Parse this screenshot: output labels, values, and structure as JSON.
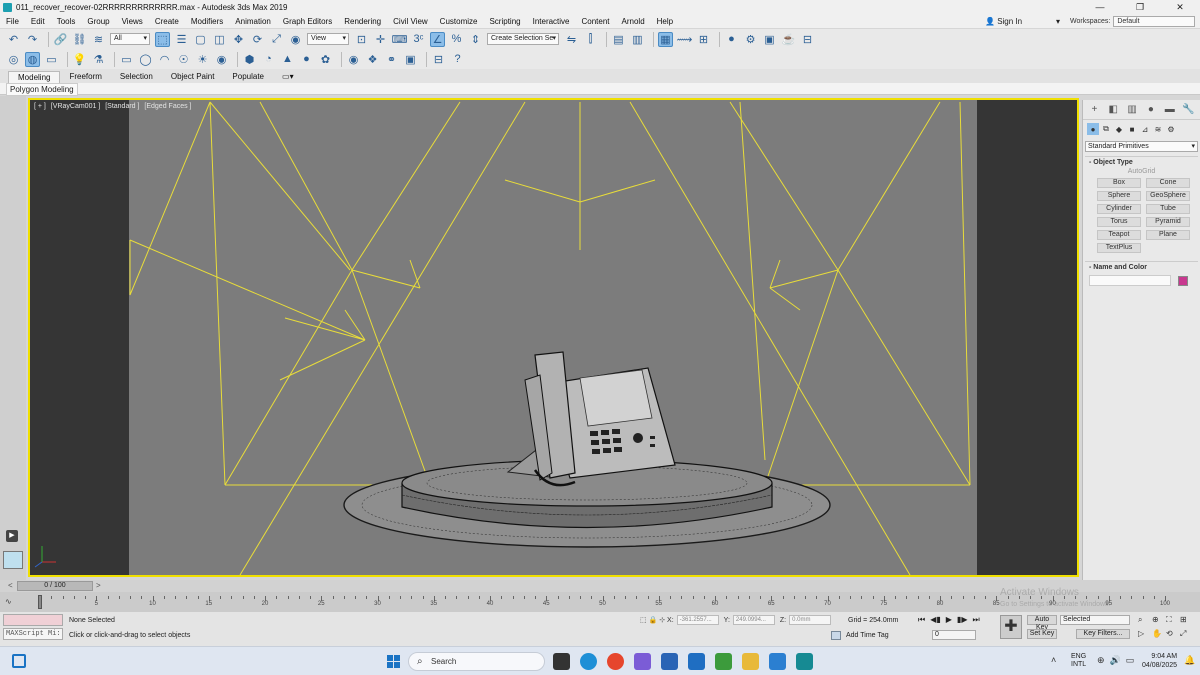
{
  "window": {
    "title": "011_recover_recover-02RRRRRRRRRRRRR.max - Autodesk 3ds Max 2019",
    "min": "—",
    "max": "❐",
    "close": "✕"
  },
  "menu": [
    "File",
    "Edit",
    "Tools",
    "Group",
    "Views",
    "Create",
    "Modifiers",
    "Animation",
    "Graph Editors",
    "Rendering",
    "Civil View",
    "Customize",
    "Scripting",
    "Interactive",
    "Content",
    "Arnold",
    "Help"
  ],
  "signin": {
    "label": "Sign In"
  },
  "workspaces": {
    "label": "Workspaces:",
    "value": "Default"
  },
  "toolbar1": {
    "filter_value": "All",
    "refcoord_value": "View",
    "selection_set": "Create Selection Se"
  },
  "ribbon": {
    "tabs": [
      "Modeling",
      "Freeform",
      "Selection",
      "Object Paint",
      "Populate"
    ],
    "active": "Modeling",
    "sub": "Polygon Modeling"
  },
  "viewport": {
    "label_parts": [
      "[ + ]",
      "[VRayCam001 ]",
      "[Standard ]",
      "[Edged Faces ]"
    ],
    "axes": {
      "x": "x",
      "y": "y",
      "z": "z"
    }
  },
  "command_panel": {
    "dropdown": "Standard Primitives",
    "object_type_title": "Object Type",
    "autogrid": "AutoGrid",
    "primitives": [
      "Box",
      "Cone",
      "Sphere",
      "GeoSphere",
      "Cylinder",
      "Tube",
      "Torus",
      "Pyramid",
      "Teapot",
      "Plane",
      "TextPlus"
    ],
    "name_color_title": "Name and Color",
    "object_color": "#c8388f"
  },
  "time_slider": {
    "frame_display": "0 / 100",
    "left_arrow": "<",
    "right_arrow": ">"
  },
  "trackbar": {
    "ticks": [
      "0",
      "5",
      "10",
      "15",
      "20",
      "25",
      "30",
      "35",
      "40",
      "45",
      "50",
      "55",
      "60",
      "65",
      "70",
      "75",
      "80",
      "85",
      "90",
      "95",
      "100"
    ],
    "max_frame": 100
  },
  "status": {
    "maxscript_label": "MAXScript Mi:",
    "selection": "None Selected",
    "prompt": "Click or click-and-drag to select objects",
    "x_label": "X:",
    "y_label": "Y:",
    "z_label": "Z:",
    "x_value": "-361.2557...",
    "y_value": "249.0994...",
    "z_value": "0.0mm",
    "grid": "Grid = 254.0mm",
    "add_time_tag": "Add Time Tag",
    "frame_value": "0",
    "auto_key": "Auto Key",
    "set_key": "Set Key",
    "selected": "Selected",
    "key_filters": "Key Filters..."
  },
  "watermark": {
    "line1": "Activate Windows",
    "line2": "Go to Settings to activate Windows."
  },
  "taskbar": {
    "search_placeholder": "Search",
    "lang_top": "ENG",
    "lang_bottom": "INTL",
    "time": "9:04 AM",
    "date": "04/08/2025"
  }
}
